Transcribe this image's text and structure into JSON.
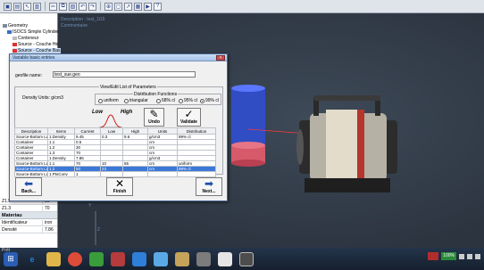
{
  "toolbar": {
    "icons": [
      "save-icon",
      "calculator-icon",
      "cursor-icon",
      "chart-icon",
      "cut-icon",
      "copy-icon",
      "paste-icon",
      "undo-icon",
      "redo-icon",
      "zoom-icon",
      "box-icon",
      "arrow-icon",
      "grid-icon",
      "run-icon",
      "help-icon"
    ]
  },
  "viewport": {
    "description": "Description : test_1G5",
    "commentaire": "Commentaire",
    "axis_y": "Y",
    "axis_z": "Z"
  },
  "tree": {
    "root": "Geometry",
    "items": [
      "ISOCS Simple Cylinder",
      "Conteneur",
      "Source - Couche Hé",
      "Source - Couche Bas"
    ]
  },
  "props": {
    "rows": [
      {
        "k": "Z1.5",
        "v": "50"
      },
      {
        "k": "Z1.3",
        "v": "70"
      }
    ],
    "section": "Materiau",
    "mat_rows": [
      {
        "k": "Identificateur",
        "v": "iron"
      },
      {
        "k": "Densité",
        "v": "7.86"
      }
    ]
  },
  "dialog": {
    "title": "Variable basic entries",
    "close": "×",
    "geofile_label": "geofile name:",
    "geofile_value": "test_sue.geo",
    "group_title": "View/Edit List of Parameters",
    "density_label": "Density Units: g/cm3",
    "dist_title": "Distribution Functions",
    "dist_options": [
      "uniform",
      "triangular",
      "68% cl",
      "95% cl",
      "99% cl"
    ],
    "dist_selected": 4,
    "low_label": "Low",
    "high_label": "High",
    "undo_label": "Undo",
    "validate_label": "Validate",
    "back_label": "Back...",
    "finish_label": "Finish",
    "next_label": "Next..."
  },
  "table": {
    "headers": [
      "Description",
      "Items",
      "Current",
      "Low",
      "High",
      "Units",
      "Distribution"
    ],
    "rows": [
      [
        "Source-Bottom Layer",
        "1.Density",
        "9.45",
        "0.3",
        "9.6",
        "g/cm3",
        "99% cl"
      ],
      [
        "Container",
        "1.1",
        "0.5",
        "",
        "",
        "cm",
        ""
      ],
      [
        "Container",
        "1.2",
        "30",
        "",
        "",
        "cm",
        ""
      ],
      [
        "Container",
        "1.3",
        "70",
        "",
        "",
        "cm",
        ""
      ],
      [
        "Container",
        "1.Density",
        "7.86",
        "",
        "",
        "g/cm3",
        ""
      ],
      [
        "Source-Bottom Layer",
        "1.1",
        "70",
        "10",
        "65",
        "cm",
        "uniform"
      ],
      [
        "Source-Bottom Layer",
        "1.2",
        "50",
        "23",
        "",
        "cm",
        "99% cl"
      ],
      [
        "Source-Bottom Layer",
        "1.PtsConv",
        "1",
        "",
        "",
        "",
        ""
      ]
    ],
    "selected_row": 6
  },
  "status": {
    "left": "Prêt"
  },
  "taskbar": {
    "tray_badge": "100%",
    "colors": {
      "ie": "#1e7fd6",
      "folder": "#e0b64a",
      "chrome": "#dd4b39",
      "media": "#3a9c3a"
    }
  }
}
